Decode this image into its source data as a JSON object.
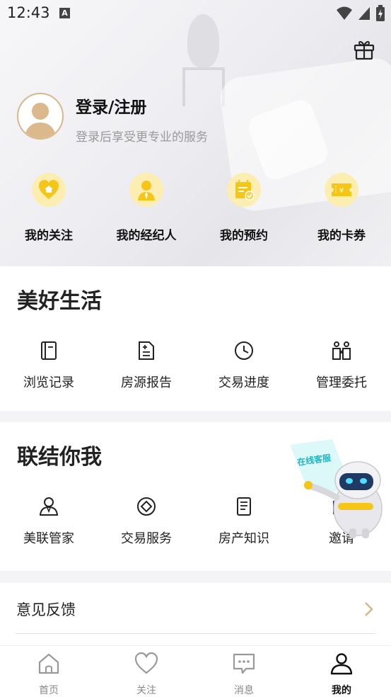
{
  "status_bar": {
    "time": "12:43",
    "notification_icon": "A"
  },
  "header": {
    "gift_icon": "gift-icon",
    "login_title": "登录/注册",
    "login_subtitle": "登录后享受更专业的服务",
    "quick_actions": [
      {
        "label": "我的关注",
        "icon": "heart-house-icon"
      },
      {
        "label": "我的经纪人",
        "icon": "agent-icon"
      },
      {
        "label": "我的预约",
        "icon": "calendar-icon"
      },
      {
        "label": "我的卡券",
        "icon": "coupon-icon"
      }
    ]
  },
  "section_life": {
    "title": "美好生活",
    "items": [
      {
        "label": "浏览记录",
        "icon": "history-icon"
      },
      {
        "label": "房源报告",
        "icon": "report-icon"
      },
      {
        "label": "交易进度",
        "icon": "clock-icon"
      },
      {
        "label": "管理委托",
        "icon": "delegate-icon"
      }
    ]
  },
  "section_connect": {
    "title": "联结你我",
    "items": [
      {
        "label": "美联管家",
        "icon": "butler-icon"
      },
      {
        "label": "交易服务",
        "icon": "service-icon"
      },
      {
        "label": "房产知识",
        "icon": "knowledge-icon"
      },
      {
        "label": "邀请",
        "icon": "invite-icon"
      }
    ],
    "robot_label": "在线客服"
  },
  "feedback": {
    "label": "意见反馈"
  },
  "tabbar": {
    "tabs": [
      {
        "label": "首页",
        "active": false
      },
      {
        "label": "关注",
        "active": false
      },
      {
        "label": "消息",
        "active": false
      },
      {
        "label": "我的",
        "active": true
      }
    ]
  },
  "colors": {
    "accent": "#f5c518",
    "gold": "#d8b88b",
    "text": "#222222"
  }
}
